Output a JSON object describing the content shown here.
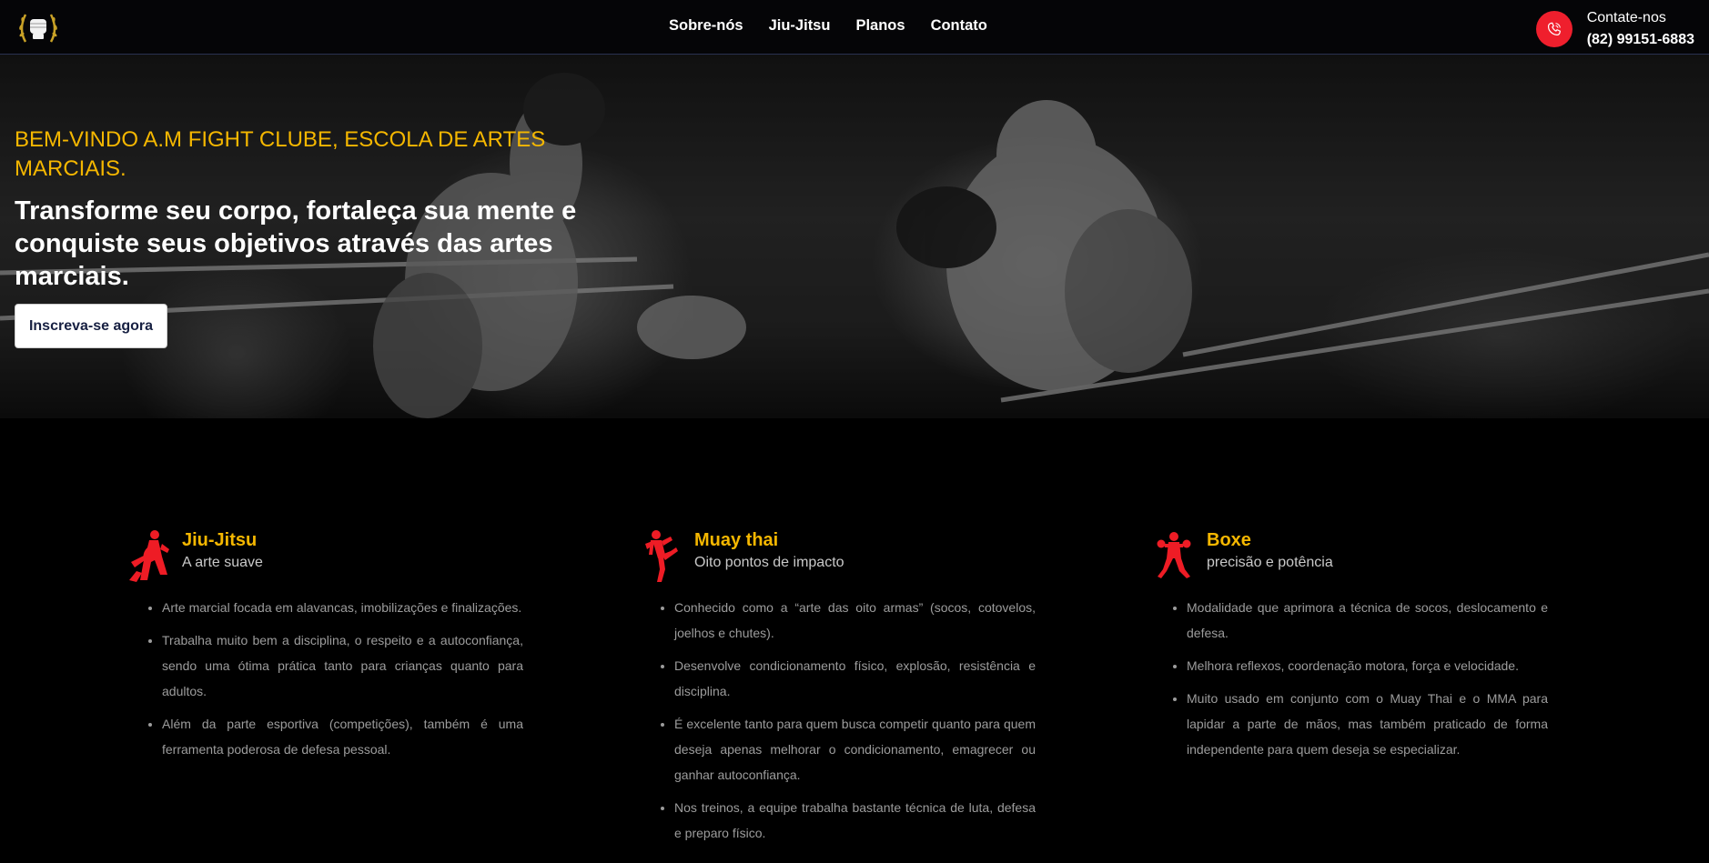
{
  "header": {
    "logo_icon": "laurel-fist-logo-icon",
    "nav": [
      "Sobre-nós",
      "Jiu-Jitsu",
      "Planos",
      "Contato"
    ],
    "contact_label": "Contate-nos",
    "contact_phone": "(82) 99151-6883",
    "contact_icon": "phone-icon",
    "accent": "#ef1f2d"
  },
  "hero": {
    "welcome": "BEM-VINDO A.M FIGHT CLUBE, ESCOLA DE ARTES MARCIAIS.",
    "title": "Transforme seu corpo, fortaleça sua mente e conquiste seus objetivos através das artes marciais.",
    "cta": "Inscreva-se agora",
    "welcome_color": "#f5b700"
  },
  "cards": [
    {
      "icon": "jiu-jitsu-figure-icon",
      "title": "Jiu-Jitsu",
      "subtitle": "A arte suave",
      "items": [
        "Arte marcial focada em alavancas, imobilizações e finalizações.",
        "Trabalha muito bem a disciplina, o respeito e a autoconfiança, sendo uma ótima prática tanto para crianças quanto para adultos.",
        "Além da parte esportiva (competições), também é uma ferramenta poderosa de defesa pessoal."
      ]
    },
    {
      "icon": "muay-thai-figure-icon",
      "title": "Muay thai",
      "subtitle": "Oito pontos de impacto",
      "items": [
        "Conhecido como a “arte das oito armas” (socos, cotovelos, joelhos e chutes).",
        "Desenvolve condicionamento físico, explosão, resistência e disciplina.",
        "É excelente tanto para quem busca competir quanto para quem deseja apenas melhorar o condicionamento, emagrecer ou ganhar autoconfiança.",
        "Nos treinos, a equipe trabalha bastante técnica de luta, defesa e preparo físico."
      ]
    },
    {
      "icon": "boxer-figure-icon",
      "title": "Boxe",
      "subtitle": "precisão e potência",
      "items": [
        "Modalidade que aprimora a técnica de socos, deslocamento e defesa.",
        "Melhora reflexos, coordenação motora, força e velocidade.",
        "Muito usado em conjunto com o Muay Thai e o MMA para lapidar a parte de mãos, mas também praticado de forma independente para quem deseja se especializar."
      ]
    }
  ]
}
